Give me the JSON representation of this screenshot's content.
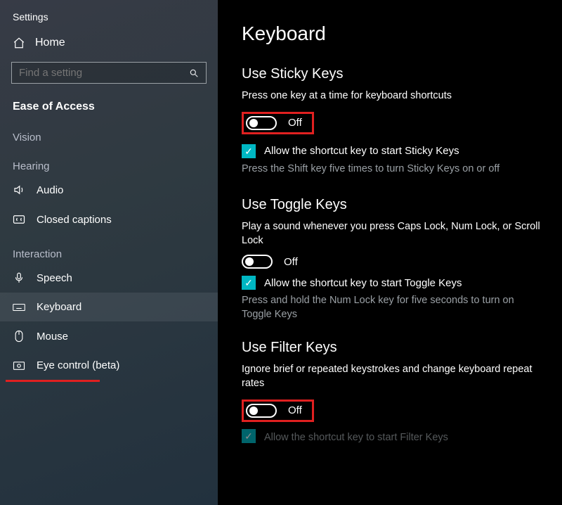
{
  "window_title": "Settings",
  "sidebar": {
    "home": "Home",
    "search_placeholder": "Find a setting",
    "category": "Ease of Access",
    "groups": {
      "vision": "Vision",
      "hearing": "Hearing",
      "interaction": "Interaction"
    },
    "items": {
      "audio": "Audio",
      "closed_captions": "Closed captions",
      "speech": "Speech",
      "keyboard": "Keyboard",
      "mouse": "Mouse",
      "eye_control": "Eye control (beta)"
    }
  },
  "main": {
    "title": "Keyboard",
    "sticky": {
      "heading": "Use Sticky Keys",
      "desc": "Press one key at a time for keyboard shortcuts",
      "toggle_state": "Off",
      "shortcut_label": "Allow the shortcut key to start Sticky Keys",
      "shortcut_sub": "Press the Shift key five times to turn Sticky Keys on or off"
    },
    "toggle": {
      "heading": "Use Toggle Keys",
      "desc": "Play a sound whenever you press Caps Lock, Num Lock, or Scroll Lock",
      "toggle_state": "Off",
      "shortcut_label": "Allow the shortcut key to start Toggle Keys",
      "shortcut_sub": "Press and hold the Num Lock key for five seconds to turn on Toggle Keys"
    },
    "filter": {
      "heading": "Use Filter Keys",
      "desc": "Ignore brief or repeated keystrokes and change keyboard repeat rates",
      "toggle_state": "Off",
      "shortcut_label_cut": "Allow the shortcut key to start Filter Keys"
    }
  }
}
